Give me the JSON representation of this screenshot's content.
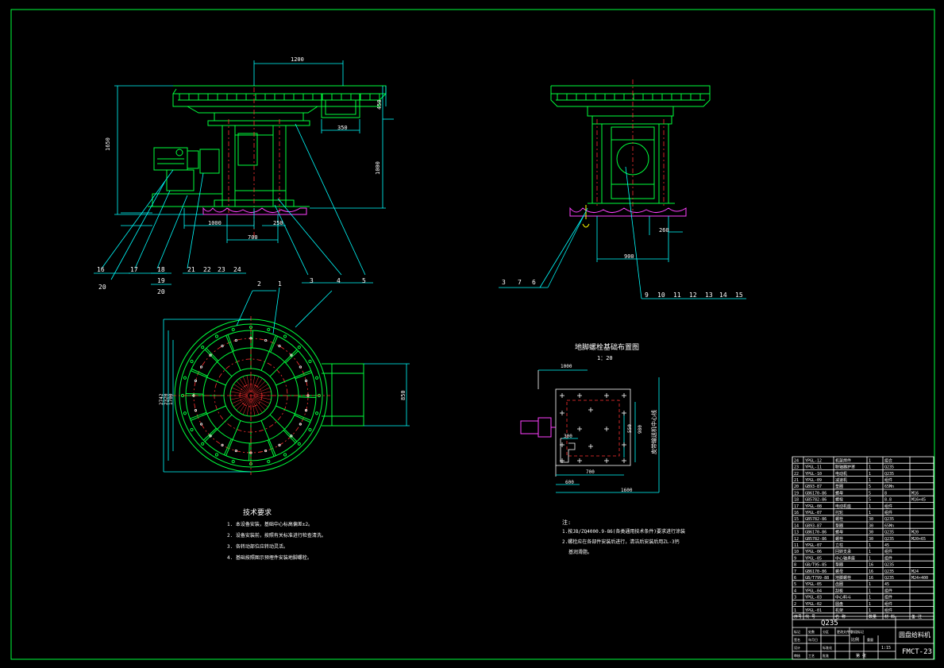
{
  "dimensions": {
    "top_width": "1200",
    "overall_height": "1650",
    "gearbox_height": "450",
    "offset_350": "350",
    "column_height": "1000",
    "base_1000": "1000",
    "base_700": "700",
    "base_250": "250",
    "side_260": "260",
    "side_900": "900",
    "plan_2742": "2742",
    "plan_2320": "2320",
    "plan_1700": "1700",
    "plan_850": "850",
    "found_1000": "1000",
    "found_300": "300",
    "found_550": "550",
    "found_700": "700",
    "found_1600": "1600",
    "found_980": "980",
    "found_600": "600"
  },
  "balloons_front": [
    "16",
    "20",
    "17",
    "18",
    "19",
    "20",
    "21",
    "22",
    "23",
    "24",
    "3",
    "4",
    "5"
  ],
  "balloons_side": [
    "3",
    "7",
    "6",
    "9",
    "10",
    "11",
    "12",
    "13",
    "14",
    "15"
  ],
  "balloons_plan": [
    "2",
    "1"
  ],
  "foundation": {
    "title": "地脚螺栓基础布置图",
    "scale": "1：20",
    "note_vertical": "皮带输送机中心线"
  },
  "tech_requirements": {
    "title": "技术要求",
    "items": [
      "1. 本设备安装，基础中心标高偏差±2。",
      "2. 设备安装前，按照有关标准进行检查清洗。",
      "3. 各转动部位应转动灵活。",
      "4. 基础按照图示预埋件安装地脚螺栓。"
    ]
  },
  "notes": {
    "title": "注:",
    "items": [
      "1.按JB/ZQ4000.9-86(各类通用技术条件)要求进行涂装",
      "2.螺栓应在各部件安装后进行，清洁后安装后用ZL-3钙",
      "基润滑脂。"
    ]
  },
  "bom": {
    "rows": [
      [
        "24",
        "YPGL-12",
        "机架焊件",
        "1",
        "组合",
        ""
      ],
      [
        "23",
        "YPGL-11",
        "联轴器护罩",
        "1",
        "Q235",
        ""
      ],
      [
        "22",
        "YPGL-10",
        "电动机",
        "1",
        "Q235",
        ""
      ],
      [
        "21",
        "YPGL-09",
        "减速机",
        "1",
        "组件",
        ""
      ],
      [
        "20",
        "GB93-87",
        "垫圈",
        "5",
        "65Mn",
        ""
      ],
      [
        "19",
        "GB6170-86",
        "螺母",
        "5",
        "8",
        "M16"
      ],
      [
        "18",
        "GB5782-86",
        "螺栓",
        "5",
        "8.8",
        "M16×45"
      ],
      [
        "17",
        "YPGL-08",
        "电动机座",
        "1",
        "组件",
        ""
      ],
      [
        "16",
        "YPGL-07",
        "托轮",
        "1",
        "组件",
        ""
      ],
      [
        "15",
        "GB5782-86",
        "螺栓",
        "30",
        "Q235",
        ""
      ],
      [
        "14",
        "GB93-87",
        "垫圈",
        "30",
        "65Mn",
        ""
      ],
      [
        "13",
        "GB6170-86",
        "螺母",
        "30",
        "Q235",
        "M20"
      ],
      [
        "12",
        "GB5782-86",
        "螺栓",
        "30",
        "Q235",
        "M20×65"
      ],
      [
        "11",
        "YPGL-07",
        "立柱",
        "1",
        "45",
        ""
      ],
      [
        "10",
        "YPGL-06",
        "回转支承",
        "1",
        "组件",
        ""
      ],
      [
        "9",
        "YPGL-05",
        "中心轴承座",
        "1",
        "组件",
        ""
      ],
      [
        "8",
        "GB/T95-85",
        "垫圈",
        "16",
        "Q235",
        ""
      ],
      [
        "7",
        "GB6170-86",
        "螺母",
        "16",
        "Q235",
        "M24"
      ],
      [
        "6",
        "GB/T799-88",
        "地脚螺栓",
        "16",
        "Q235",
        "M24×400"
      ],
      [
        "5",
        "YPGL-05",
        "齿圈",
        "1",
        "45",
        ""
      ],
      [
        "4",
        "YPGL-04",
        "刮板",
        "1",
        "组件",
        ""
      ],
      [
        "3",
        "YPGL-03",
        "中心料斗",
        "1",
        "组件",
        ""
      ],
      [
        "2",
        "YPGL-02",
        "圆盘",
        "1",
        "组件",
        ""
      ],
      [
        "1",
        "YPGL-01",
        "机架",
        "1",
        "组件",
        ""
      ]
    ],
    "header": [
      "序号",
      "代 号",
      "名 称",
      "数量",
      "材 料",
      "备 注"
    ]
  },
  "title_block": {
    "material": "Q235",
    "product_name": "圆盘给料机",
    "drawing_no": "FMCT-23",
    "scale_label": "比例",
    "scale_value": "1:15",
    "sheet_label": "第 张",
    "labels": [
      "标记",
      "处数",
      "分区",
      "更改文件号",
      "签名",
      "年月日",
      "设计",
      "标准化",
      "审核",
      "工艺",
      "批准",
      "阶段标记",
      "重量"
    ]
  }
}
